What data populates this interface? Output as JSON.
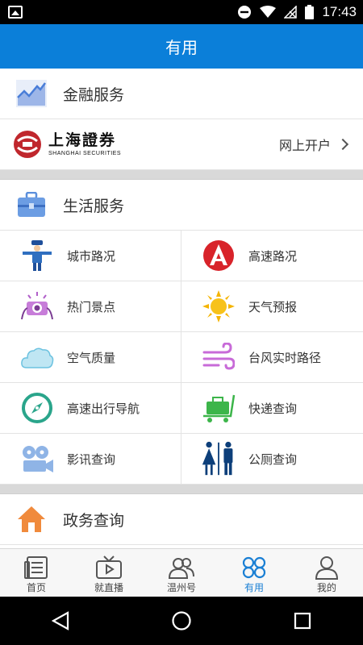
{
  "status_bar": {
    "time": "17:43"
  },
  "header": {
    "title": "有用"
  },
  "finance": {
    "title": "金融服务",
    "brand_cn": "上海證券",
    "brand_en": "SHANGHAI SECURITIES",
    "open_account": "网上开户"
  },
  "life": {
    "title": "生活服务",
    "items": [
      {
        "label": "城市路况",
        "icon": "traffic-police-icon"
      },
      {
        "label": "高速路况",
        "icon": "highway-icon"
      },
      {
        "label": "热门景点",
        "icon": "camera-icon"
      },
      {
        "label": "天气预报",
        "icon": "sun-icon"
      },
      {
        "label": "空气质量",
        "icon": "cloud-icon"
      },
      {
        "label": "台风实时路径",
        "icon": "wind-icon"
      },
      {
        "label": "高速出行导航",
        "icon": "compass-icon"
      },
      {
        "label": "快递查询",
        "icon": "cart-icon"
      },
      {
        "label": "影讯查询",
        "icon": "film-projector-icon"
      },
      {
        "label": "公厕查询",
        "icon": "restroom-icon"
      }
    ]
  },
  "gov": {
    "title": "政务查询"
  },
  "bottom_nav": {
    "items": [
      {
        "label": "首页",
        "icon": "newspaper-icon",
        "active": false
      },
      {
        "label": "就直播",
        "icon": "tv-icon",
        "active": false
      },
      {
        "label": "温州号",
        "icon": "users-icon",
        "active": false
      },
      {
        "label": "有用",
        "icon": "grid-icon",
        "active": true
      },
      {
        "label": "我的",
        "icon": "user-icon",
        "active": false
      }
    ]
  },
  "colors": {
    "header": "#0b7fd9",
    "active_tab": "#1a7fd4"
  }
}
